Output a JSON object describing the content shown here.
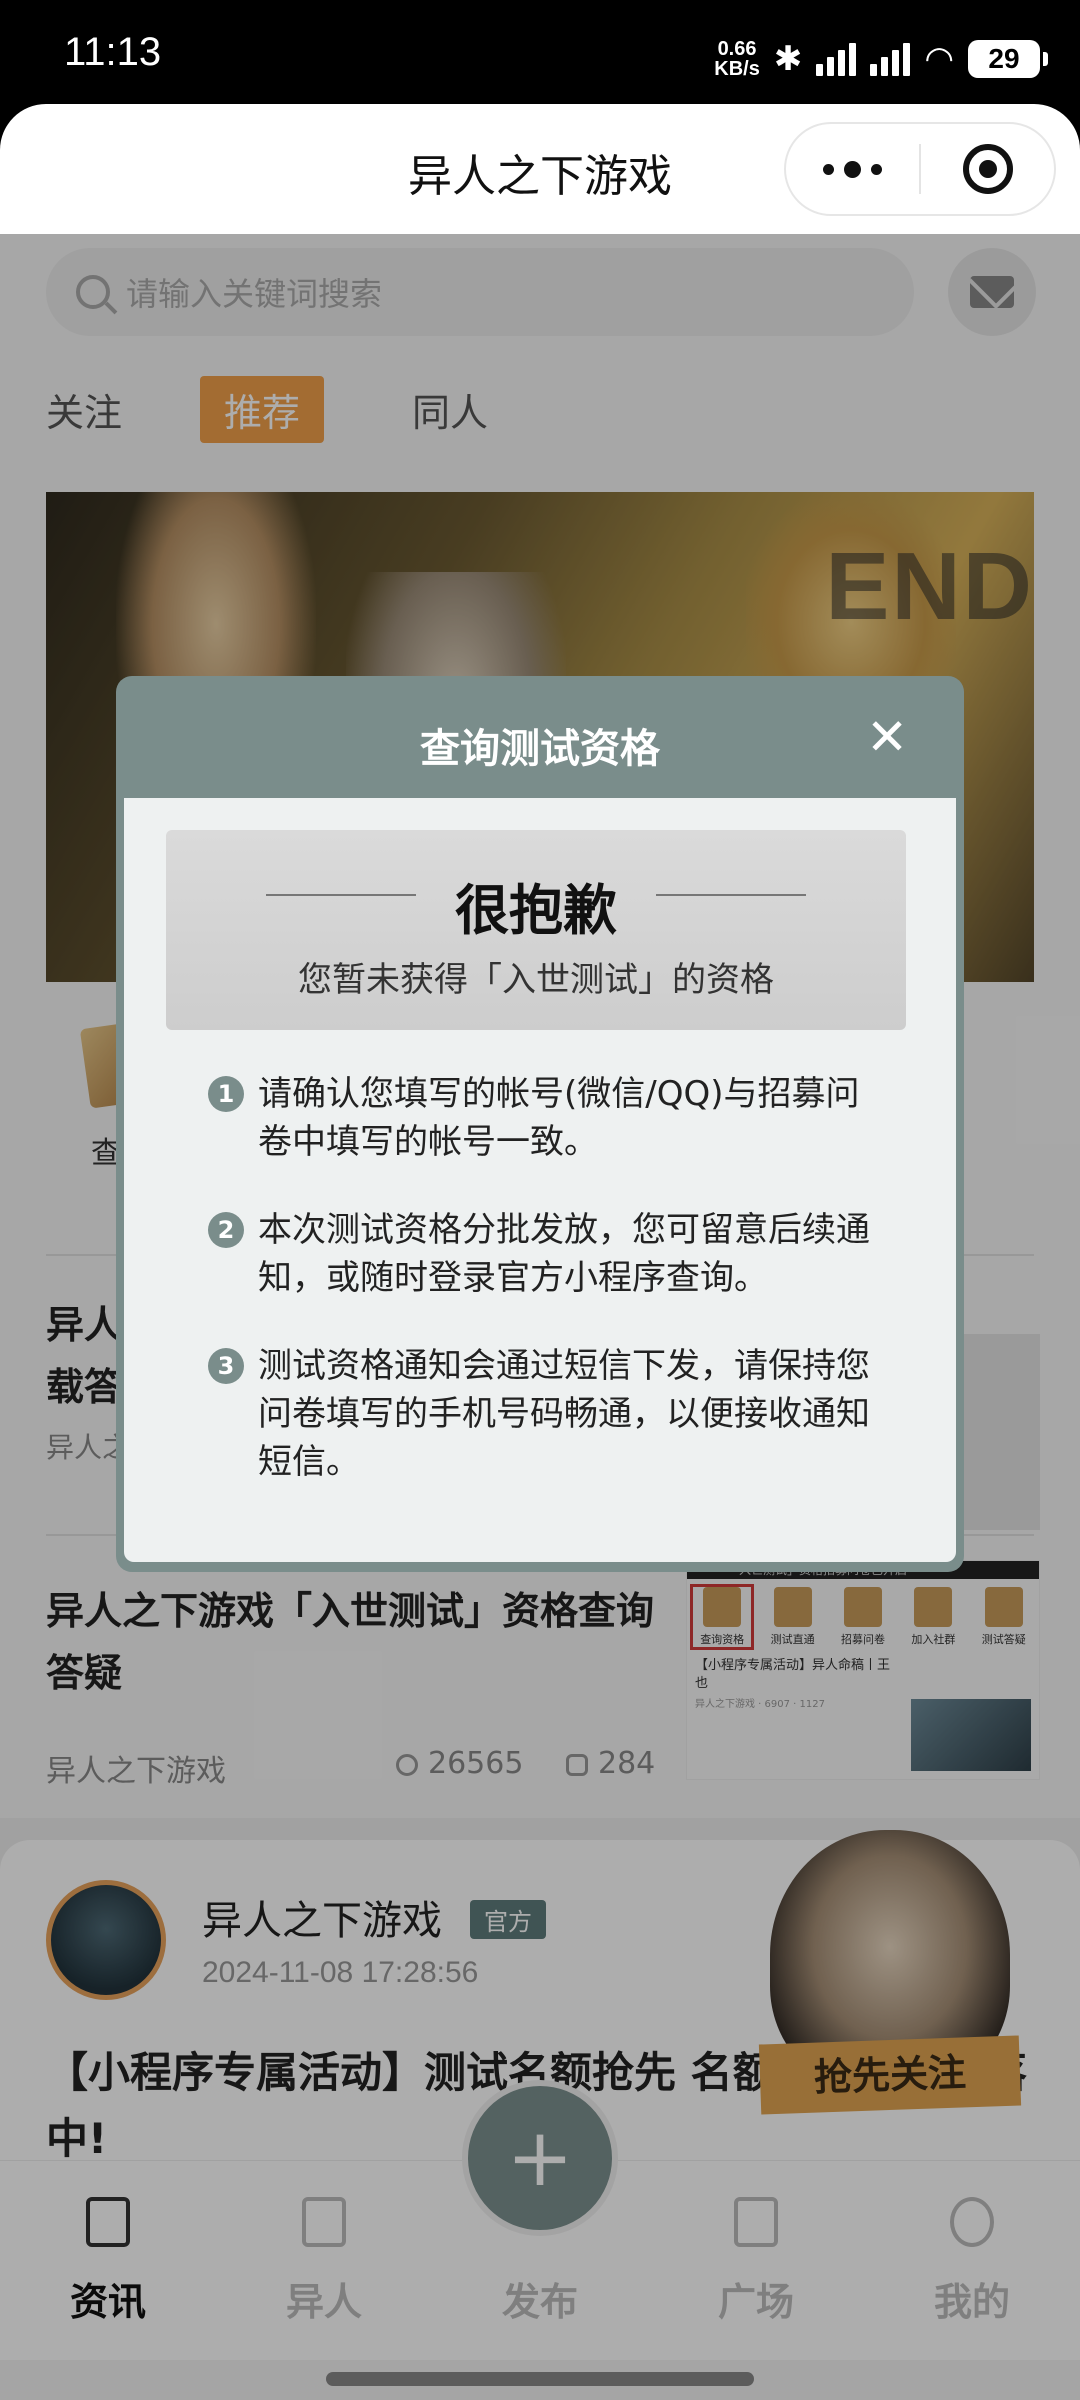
{
  "status_bar": {
    "time": "11:13",
    "speed_value": "0.66",
    "speed_unit": "KB/s",
    "battery": "29"
  },
  "app": {
    "title": "异人之下游戏"
  },
  "search": {
    "placeholder": "请输入关键词搜索"
  },
  "tabs": [
    {
      "label": "关注"
    },
    {
      "label": "推荐"
    },
    {
      "label": "同人"
    }
  ],
  "quick_links": [
    {
      "label": "查询"
    }
  ],
  "news": [
    {
      "title_line1": "异人",
      "title_line2": "载答",
      "source": "异人之"
    },
    {
      "title": "异人之下游戏「入世测试」资格查询答疑",
      "source": "异人之下游戏",
      "views": "26565",
      "comments": "284",
      "thumb": {
        "header": "「入世测试」资格招募问卷已开启",
        "items": [
          "查询资格",
          "测试直通",
          "招募问卷",
          "加入社群",
          "测试答疑"
        ],
        "caption": "【小程序专属活动】异人命稿丨王也",
        "sub": "异人之下游戏",
        "views": "6907",
        "comments": "1127"
      }
    }
  ],
  "post": {
    "author": "异人之下游戏",
    "badge": "官方",
    "date": "2024-11-08 17:28:56",
    "title": "【小程序专属活动】测试名额抢先 名额测试资格掉落中!",
    "follow": "抢先关注"
  },
  "bottom_nav": [
    {
      "label": "资讯"
    },
    {
      "label": "异人"
    },
    {
      "label": "发布"
    },
    {
      "label": "广场"
    },
    {
      "label": "我的"
    }
  ],
  "fab": {
    "label": "+"
  },
  "modal": {
    "title": "查询测试资格",
    "close": "✕",
    "heading": "很抱歉",
    "subtitle": "您暂未获得「入世测试」的资格",
    "items": [
      {
        "num": "1",
        "text": "请确认您填写的帐号(微信/QQ)与招募问卷中填写的帐号一致。"
      },
      {
        "num": "2",
        "text": "本次测试资格分批发放，您可留意后续通知，或随时登录官方小程序查询。"
      },
      {
        "num": "3",
        "text": "测试资格通知会通过短信下发，请保持您问卷填写的手机号码畅通，以便接收通知短信。"
      }
    ]
  }
}
